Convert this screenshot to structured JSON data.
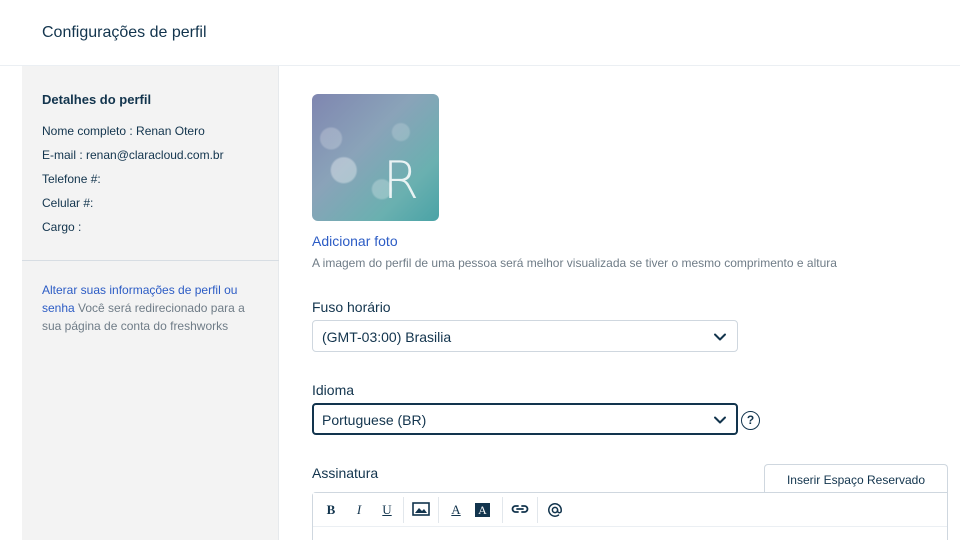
{
  "page": {
    "title": "Configurações de perfil"
  },
  "sidebar": {
    "heading": "Detalhes do perfil",
    "details": [
      {
        "label": "Nome completo : ",
        "value": "Renan Otero"
      },
      {
        "label": "E-mail : ",
        "value": "renan@claracloud.com.br"
      },
      {
        "label": "Telefone #:",
        "value": ""
      },
      {
        "label": "Celular #:",
        "value": ""
      },
      {
        "label": "Cargo :",
        "value": ""
      }
    ],
    "note_link": "Alterar suas informações de perfil ou senha",
    "note_text": " Você será redirecionado para a sua página de conta do freshworks"
  },
  "avatar": {
    "initial": "R"
  },
  "photo": {
    "add_label": "Adicionar foto",
    "hint": "A imagem do perfil de uma pessoa será melhor visualizada se tiver o mesmo comprimento e altura"
  },
  "timezone": {
    "label": "Fuso horário",
    "value": "(GMT-03:00) Brasilia"
  },
  "language": {
    "label": "Idioma",
    "value": "Portuguese (BR)"
  },
  "signature": {
    "label": "Assinatura",
    "placeholder_button": "Inserir Espaço Reservado",
    "toolbar": [
      "bold-icon",
      "italic-icon",
      "underline-icon",
      "image-icon",
      "font-color-icon",
      "background-color-icon",
      "link-icon",
      "mention-icon"
    ]
  }
}
